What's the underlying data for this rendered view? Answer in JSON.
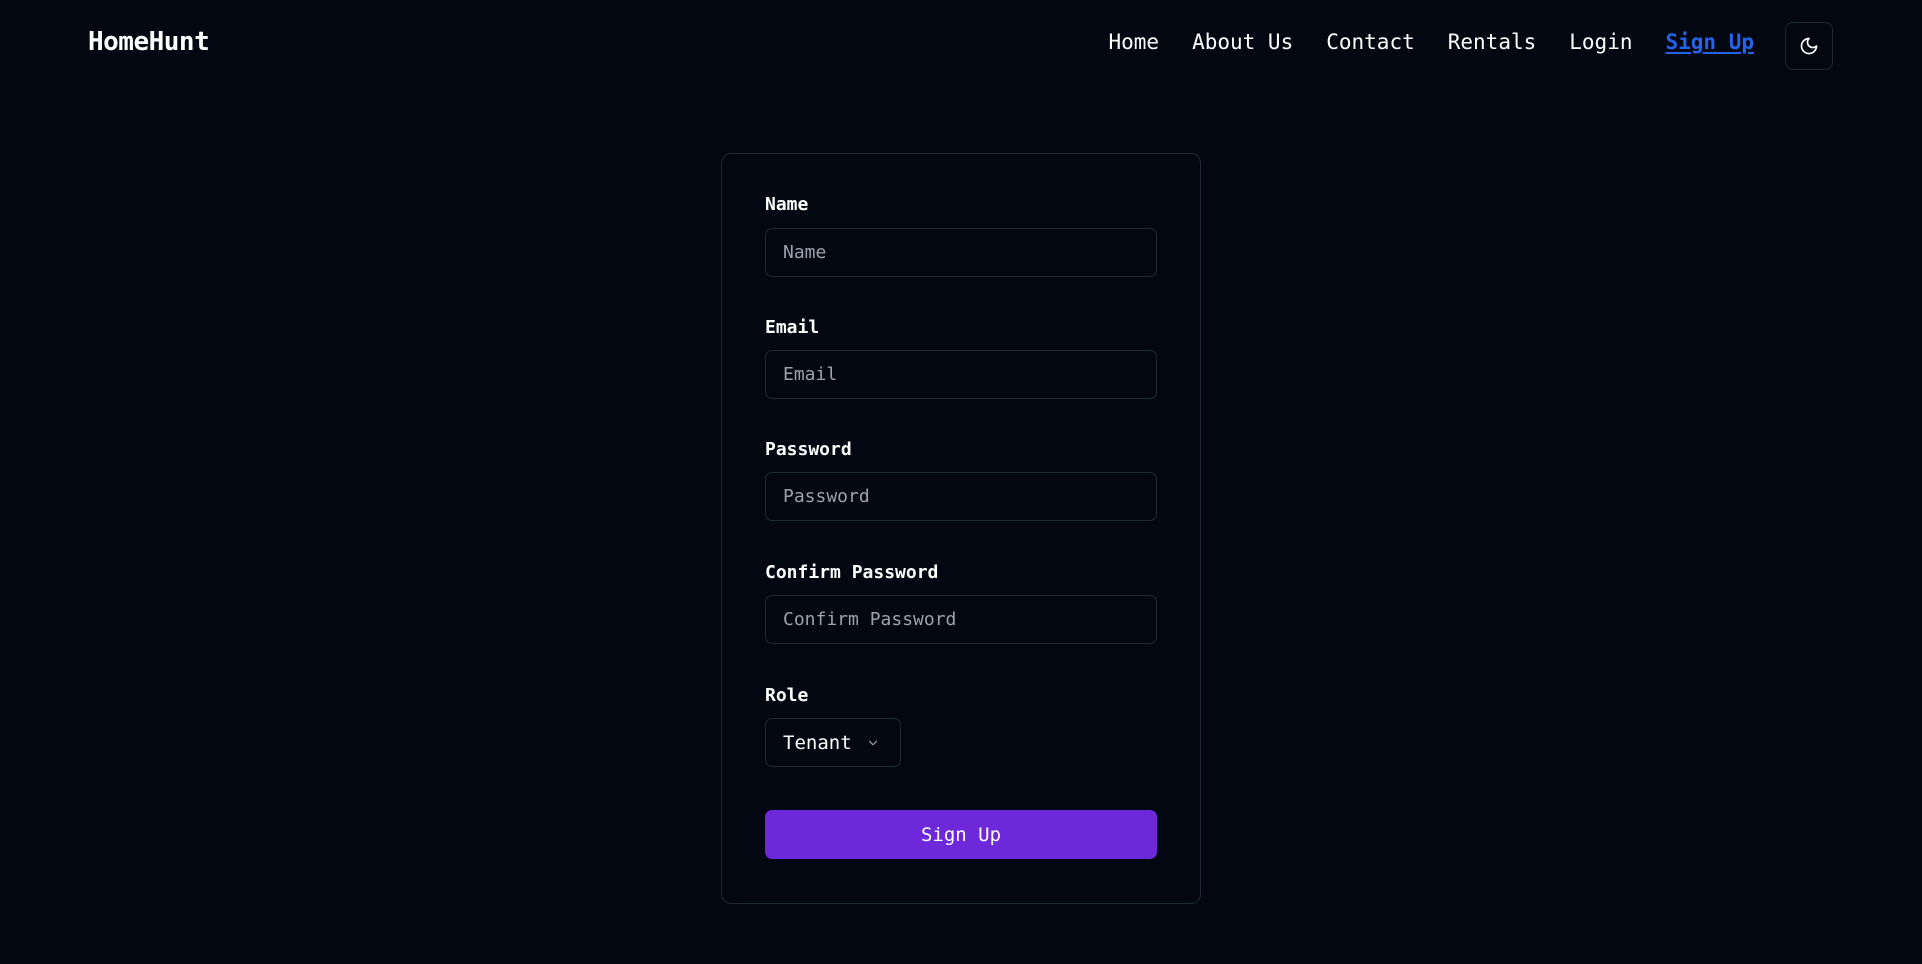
{
  "brand": {
    "name": "HomeHunt"
  },
  "nav": {
    "items": [
      {
        "label": "Home",
        "active": false
      },
      {
        "label": "About Us",
        "active": false
      },
      {
        "label": "Contact",
        "active": false
      },
      {
        "label": "Rentals",
        "active": false
      },
      {
        "label": "Login",
        "active": false
      },
      {
        "label": "Sign Up",
        "active": true
      }
    ],
    "theme_toggle_icon": "moon-icon"
  },
  "form": {
    "name": {
      "label": "Name",
      "placeholder": "Name",
      "value": ""
    },
    "email": {
      "label": "Email",
      "placeholder": "Email",
      "value": ""
    },
    "password": {
      "label": "Password",
      "placeholder": "Password",
      "value": ""
    },
    "confirm_password": {
      "label": "Confirm Password",
      "placeholder": "Confirm Password",
      "value": ""
    },
    "role": {
      "label": "Role",
      "selected": "Tenant",
      "icon": "chevron-down-icon"
    },
    "submit_label": "Sign Up"
  },
  "colors": {
    "background": "#030712",
    "border": "#1f2937",
    "accent_link": "#2563eb",
    "button": "#6d28d9",
    "placeholder": "#9ca3af"
  }
}
